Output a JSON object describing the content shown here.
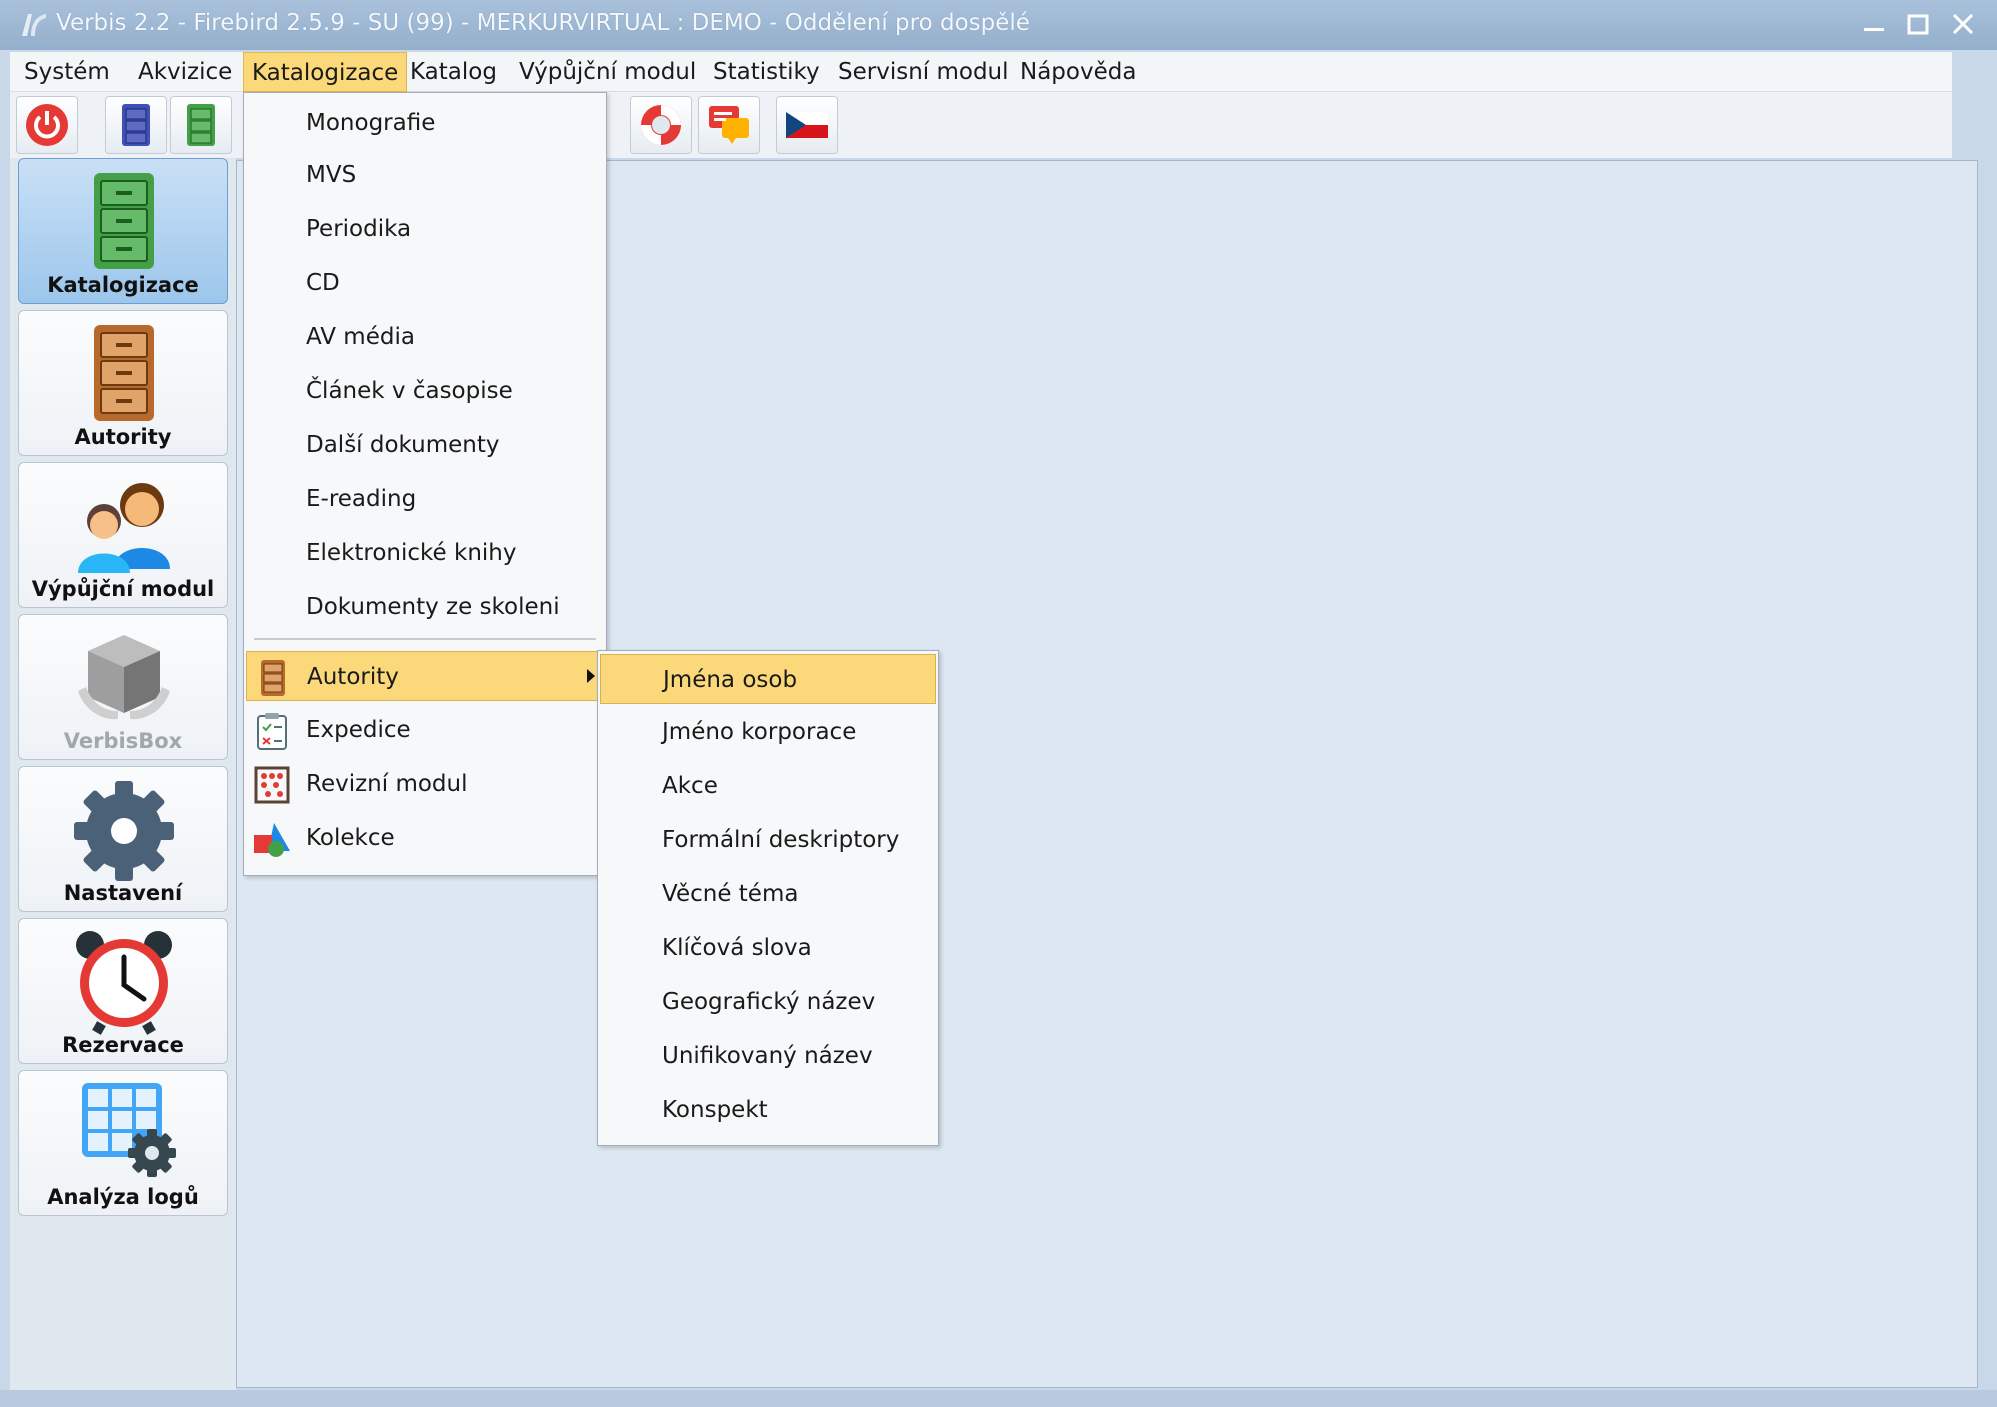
{
  "window": {
    "title": "Verbis 2.2 - Firebird 2.5.9 - SU (99) - MERKURVIRTUAL : DEMO - Oddělení pro dospělé"
  },
  "menubar": {
    "items": [
      "Systém",
      "Akvizice",
      "Katalogizace",
      "Katalog",
      "Výpůjční modul",
      "Statistiky",
      "Servisní modul",
      "Nápověda"
    ],
    "active": "Katalogizace"
  },
  "sidebar": {
    "items": [
      {
        "label": "Katalogizace",
        "icon": "green-cabinet-icon",
        "selected": true
      },
      {
        "label": "Autority",
        "icon": "brown-cabinet-icon"
      },
      {
        "label": "Výpůjční modul",
        "icon": "people-icon"
      },
      {
        "label": "VerbisBox",
        "icon": "box-icon",
        "disabled": true
      },
      {
        "label": "Nastavení",
        "icon": "gear-icon"
      },
      {
        "label": "Rezervace",
        "icon": "alarm-clock-icon"
      },
      {
        "label": "Analýza logů",
        "icon": "grid-gear-icon"
      }
    ]
  },
  "katalogizace_menu": {
    "items": [
      "Monografie",
      "MVS",
      "Periodika",
      "CD",
      "AV média",
      "Článek v časopise",
      "Další dokumenty",
      "E-reading",
      "Elektronické knihy",
      "Dokumenty ze skoleni"
    ],
    "items2": [
      "Autority",
      "Expedice",
      "Revizní modul",
      "Kolekce"
    ],
    "highlighted": "Autority"
  },
  "autority_submenu": {
    "items": [
      "Jména osob",
      "Jméno korporace",
      "Akce",
      "Formální deskriptory",
      "Věcné téma",
      "Klíčová slova",
      "Geografický název",
      "Unifikovaný název",
      "Konspekt"
    ],
    "highlighted": "Jména osob"
  },
  "colors": {
    "highlight": "#fbd97a",
    "titlebar": "#a9c1db",
    "sidebar_selected": "#9cc6ec"
  }
}
